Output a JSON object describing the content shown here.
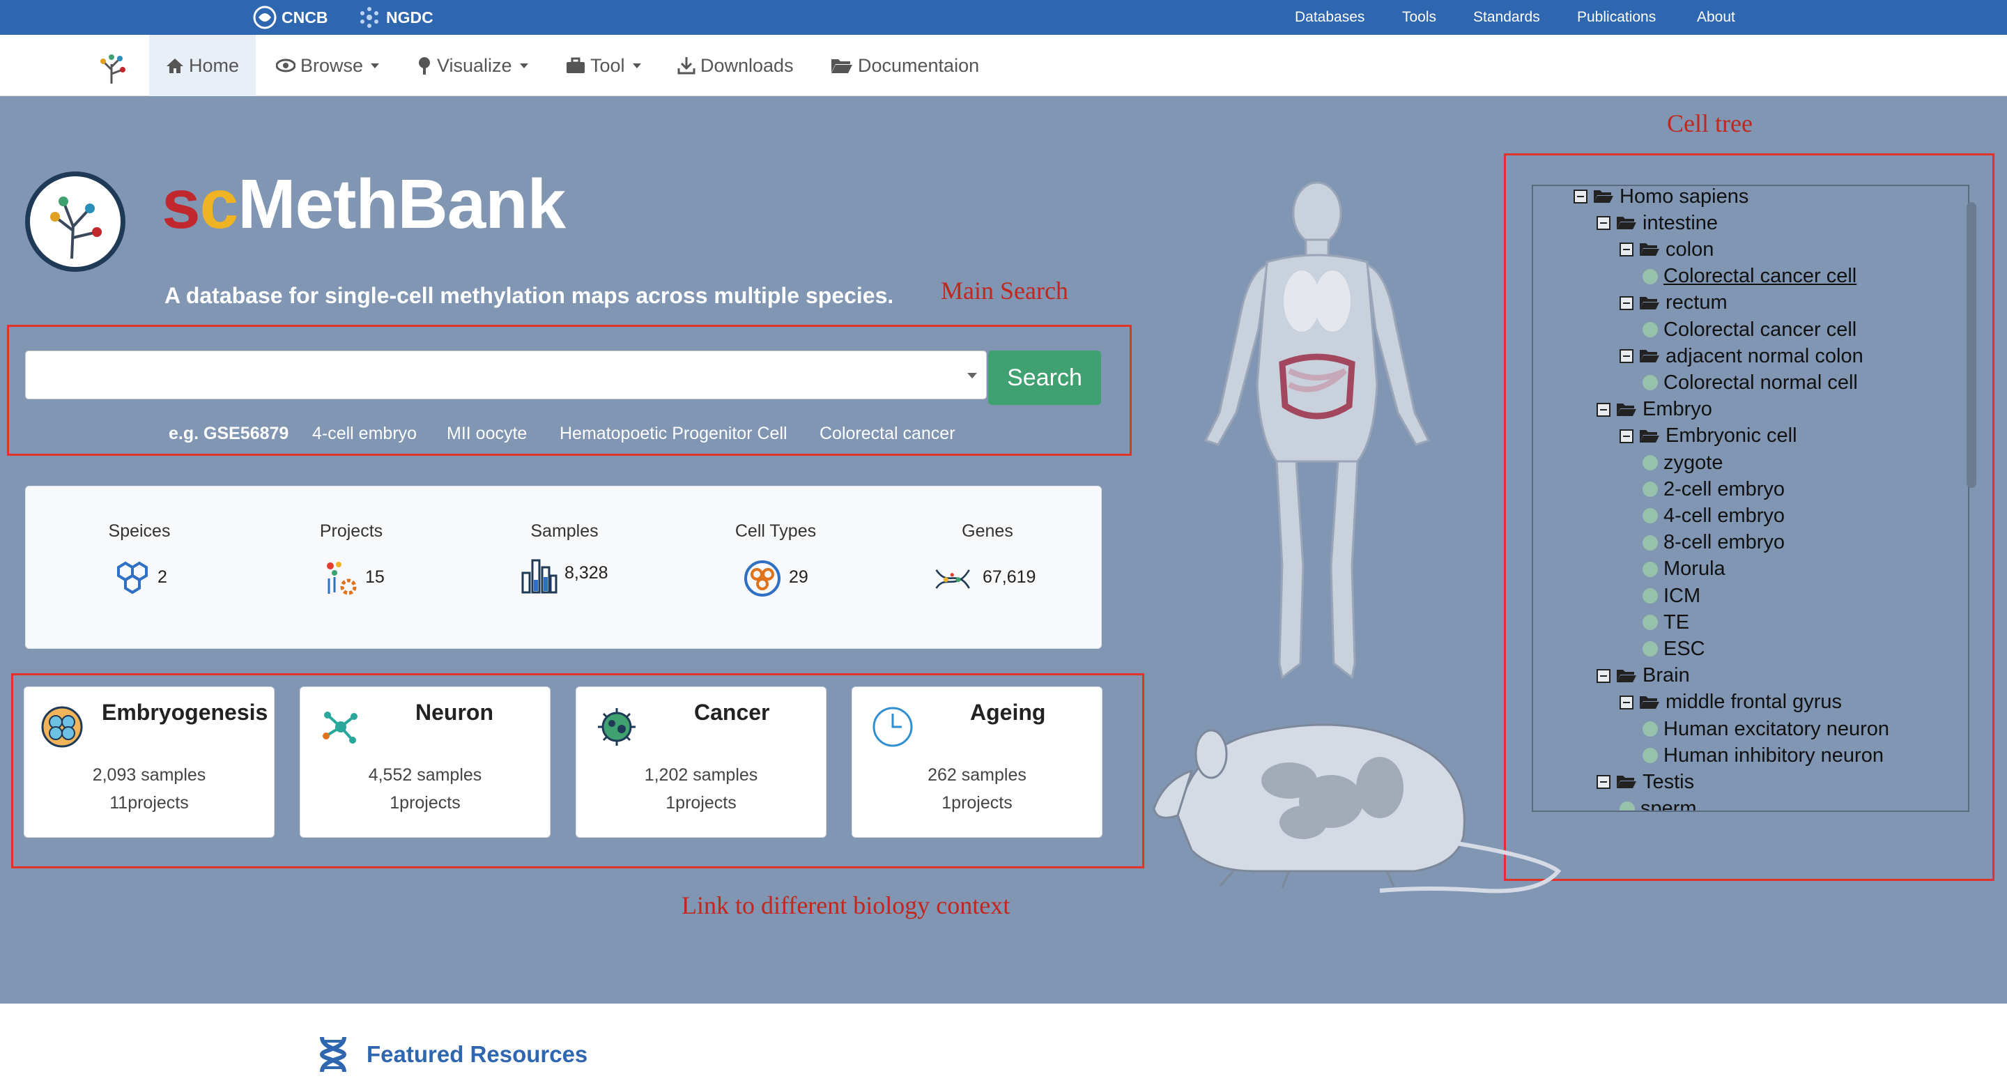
{
  "topbar": {
    "brands": [
      "CNCB",
      "NGDC"
    ],
    "links": [
      "Databases",
      "Tools",
      "Standards",
      "Publications",
      "About"
    ]
  },
  "nav": {
    "items": [
      {
        "label": "Home",
        "icon": "home-icon",
        "active": true,
        "dropdown": false
      },
      {
        "label": "Browse",
        "icon": "eye-icon",
        "active": false,
        "dropdown": true
      },
      {
        "label": "Visualize",
        "icon": "tree-icon",
        "active": false,
        "dropdown": true
      },
      {
        "label": "Tool",
        "icon": "toolbox-icon",
        "active": false,
        "dropdown": true
      },
      {
        "label": "Downloads",
        "icon": "download-icon",
        "active": false,
        "dropdown": false
      },
      {
        "label": "Documentaion",
        "icon": "folder-open-icon",
        "active": false,
        "dropdown": false
      }
    ]
  },
  "hero": {
    "title_part1": "sc",
    "title_part2": "MethBank",
    "tagline": "A database for single-cell methylation maps across multiple species."
  },
  "annotations": {
    "cell_tree": "Cell tree",
    "main_search": "Main Search",
    "link_contexts": "Link to different biology context"
  },
  "search": {
    "value": "",
    "button_label": "Search",
    "examples": [
      "e.g. GSE56879",
      "4-cell embryo",
      "MII oocyte",
      "Hematopoetic Progenitor Cell",
      "Colorectal cancer"
    ]
  },
  "stats": [
    {
      "label": "Speices",
      "value": "2",
      "icon": "hexagons-icon"
    },
    {
      "label": "Projects",
      "value": "15",
      "icon": "project-gear-icon"
    },
    {
      "label": "Samples",
      "value": "8,328",
      "icon": "test-tubes-icon"
    },
    {
      "label": "Cell Types",
      "value": "29",
      "icon": "cells-icon"
    },
    {
      "label": "Genes",
      "value": "67,619",
      "icon": "dna-icon"
    }
  ],
  "cards": [
    {
      "title": "Embryogenesis",
      "samples": "2,093 samples",
      "projects": "11projects",
      "icon": "embryo-icon"
    },
    {
      "title": "Neuron",
      "samples": "4,552 samples",
      "projects": "1projects",
      "icon": "neuron-icon"
    },
    {
      "title": "Cancer",
      "samples": "1,202 samples",
      "projects": "1projects",
      "icon": "cancer-cell-icon"
    },
    {
      "title": "Ageing",
      "samples": "262 samples",
      "projects": "1projects",
      "icon": "clock-icon"
    }
  ],
  "tree": [
    {
      "label": "Homo sapiens",
      "type": "folder"
    },
    {
      "label": "intestine",
      "type": "folder"
    },
    {
      "label": "colon",
      "type": "folder"
    },
    {
      "label": "Colorectal cancer cell",
      "type": "leaf",
      "linked": true
    },
    {
      "label": "rectum",
      "type": "folder"
    },
    {
      "label": "Colorectal cancer cell",
      "type": "leaf"
    },
    {
      "label": "adjacent normal colon",
      "type": "folder"
    },
    {
      "label": "Colorectal normal cell",
      "type": "leaf"
    },
    {
      "label": "Embryo",
      "type": "folder"
    },
    {
      "label": "Embryonic cell",
      "type": "folder"
    },
    {
      "label": "zygote",
      "type": "leaf"
    },
    {
      "label": "2-cell embryo",
      "type": "leaf"
    },
    {
      "label": "4-cell embryo",
      "type": "leaf"
    },
    {
      "label": "8-cell embryo",
      "type": "leaf"
    },
    {
      "label": "Morula",
      "type": "leaf"
    },
    {
      "label": "ICM",
      "type": "leaf"
    },
    {
      "label": "TE",
      "type": "leaf"
    },
    {
      "label": "ESC",
      "type": "leaf"
    },
    {
      "label": "Brain",
      "type": "folder"
    },
    {
      "label": "middle frontal gyrus",
      "type": "folder"
    },
    {
      "label": "Human excitatory neuron",
      "type": "leaf"
    },
    {
      "label": "Human inhibitory neuron",
      "type": "leaf"
    },
    {
      "label": "Testis",
      "type": "folder"
    },
    {
      "label": "sperm",
      "type": "leaf"
    }
  ],
  "featured": {
    "title": "Featured Resources"
  }
}
